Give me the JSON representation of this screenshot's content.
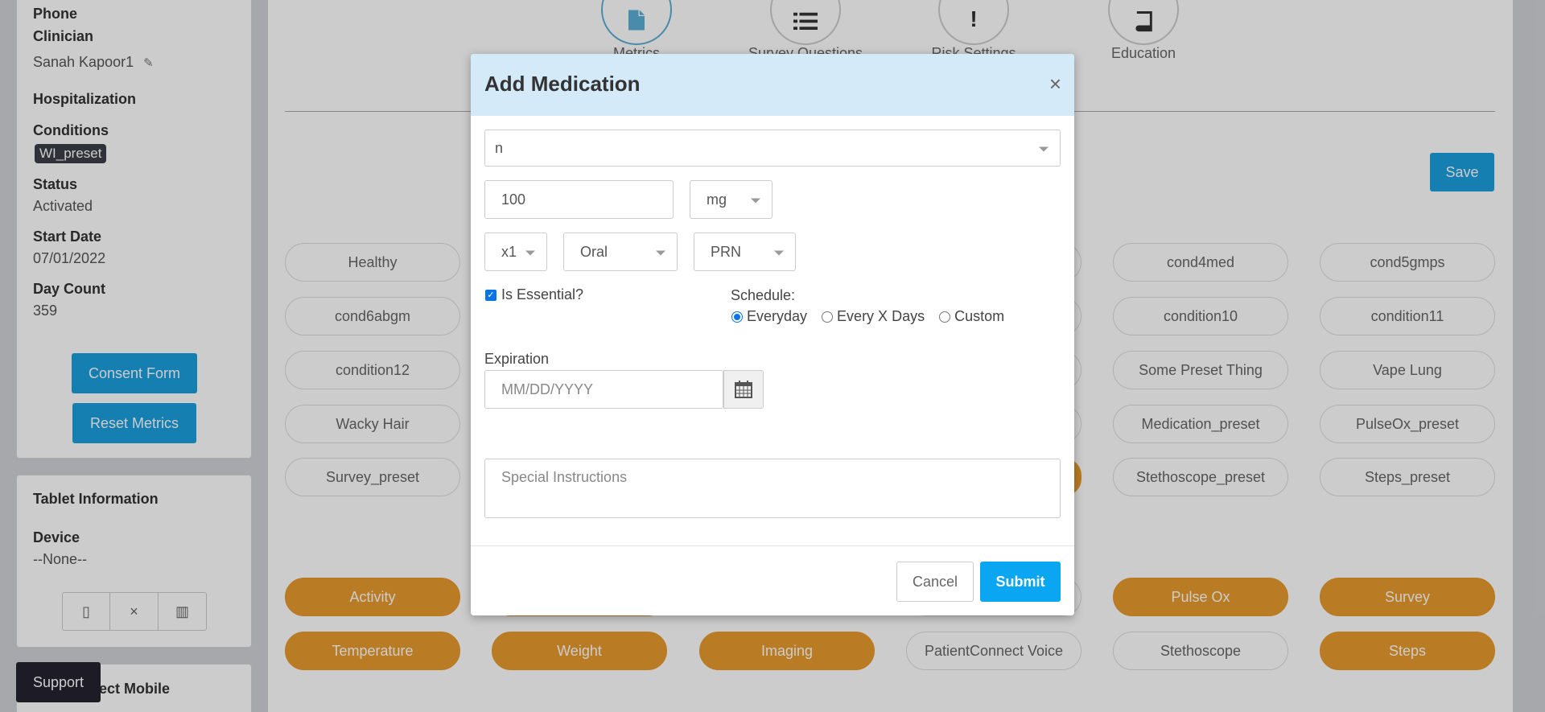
{
  "patient": {
    "phone_label": "Phone",
    "clinician_label": "Clinician",
    "clinician_name": "Sanah Kapoor1",
    "hospitalization_label": "Hospitalization",
    "conditions_label": "Conditions",
    "condition_tag": "WI_preset",
    "status_label": "Status",
    "status_value": "Activated",
    "start_date_label": "Start Date",
    "start_date_value": "07/01/2022",
    "day_count_label": "Day Count",
    "day_count_value": "359",
    "consent_form_button": "Consent Form",
    "reset_metrics_button": "Reset Metrics"
  },
  "tablet": {
    "title": "Tablet Information",
    "device_label": "Device",
    "device_value": "--None--",
    "buttons": [
      "tablet-icon",
      "close-icon",
      "barcode-icon"
    ]
  },
  "mobile": {
    "title": "nnect Mobile"
  },
  "support_label": "Support",
  "tabs": [
    {
      "label": "Metrics",
      "icon": "document-icon"
    },
    {
      "label": "Survey Questions",
      "icon": "list-icon"
    },
    {
      "label": "Risk Settings",
      "icon": "exclamation-icon"
    },
    {
      "label": "Education",
      "icon": "book-icon"
    }
  ],
  "save_label": "Save",
  "preset_pills": [
    "Healthy",
    "cond4med",
    "cond5gmps",
    "cond6abgm",
    "condition10",
    "condition11",
    "condition12",
    "Some Preset Thing",
    "Vape Lung",
    "Wacky Hair",
    "Medication_preset",
    "PulseOx_preset",
    "Survey_preset",
    "Stethoscope_preset",
    "Steps_preset"
  ],
  "metric_pills": [
    "Activity",
    "Pulse Ox",
    "Survey",
    "Temperature",
    "Weight",
    "Imaging",
    "PatientConnect Voice",
    "Stethoscope",
    "Steps"
  ],
  "colors": {
    "accent": "#1a9fdd",
    "orange": "#e89a2c",
    "submit": "#0aa6f2",
    "modal_header": "#d4eaf9"
  },
  "modal": {
    "title": "Add Medication",
    "close_symbol": "×",
    "medication_value": "n",
    "dose_value": "100",
    "unit_value": "mg",
    "frequency_value": "x1",
    "route_value": "Oral",
    "timing_value": "PRN",
    "essential_label": "Is Essential?",
    "essential_checked": true,
    "schedule_label": "Schedule:",
    "schedule_options": [
      "Everyday",
      "Every X Days",
      "Custom"
    ],
    "schedule_selected": "Everyday",
    "expiration_label": "Expiration",
    "expiration_placeholder": "MM/DD/YYYY",
    "instructions_placeholder": "Special Instructions",
    "cancel_label": "Cancel",
    "submit_label": "Submit"
  }
}
